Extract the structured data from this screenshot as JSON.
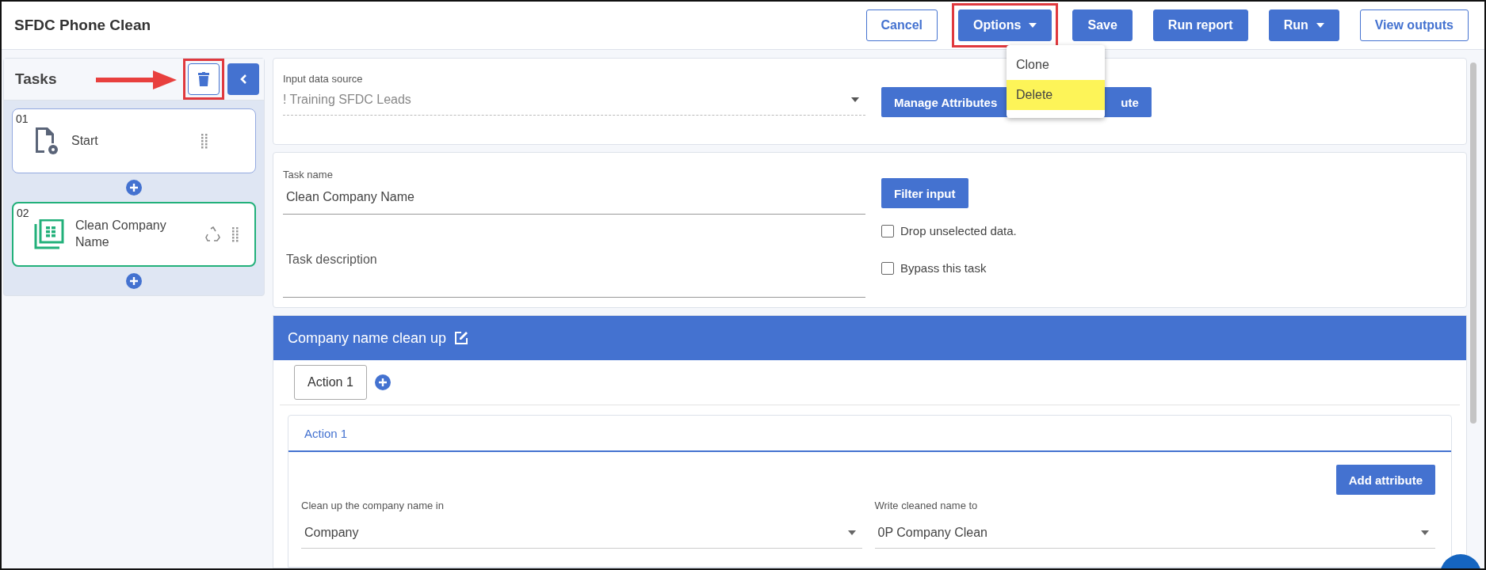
{
  "header": {
    "title": "SFDC Phone Clean",
    "buttons": [
      {
        "label": "Cancel",
        "kind": "outline",
        "caret": false,
        "highlighted": false
      },
      {
        "label": "Options",
        "kind": "solid",
        "caret": true,
        "highlighted": true
      },
      {
        "label": "Save",
        "kind": "solid",
        "caret": false,
        "highlighted": false
      },
      {
        "label": "Run report",
        "kind": "solid",
        "caret": false,
        "highlighted": false
      },
      {
        "label": "Run",
        "kind": "solid",
        "caret": true,
        "highlighted": false
      },
      {
        "label": "View outputs",
        "kind": "outline",
        "caret": false,
        "highlighted": false
      }
    ]
  },
  "options_menu": {
    "items": [
      {
        "label": "Clone",
        "selected": false
      },
      {
        "label": "Delete",
        "selected": true
      }
    ]
  },
  "sidebar": {
    "title": "Tasks",
    "delete_highlighted": true,
    "tasks": [
      {
        "number": "01",
        "name": "Start",
        "kind": "start",
        "selected": false
      },
      {
        "number": "02",
        "name": "Clean Company Name",
        "kind": "table",
        "selected": true
      }
    ]
  },
  "source_card": {
    "label": "Input data source",
    "value": "! Training SFDC Leads",
    "disabled": true,
    "buttons": [
      "Manage Attributes",
      "ute"
    ]
  },
  "task_card": {
    "name_label": "Task name",
    "name_value": "Clean Company Name",
    "description_placeholder": "Task description",
    "filter_button": "Filter input",
    "checkboxes": [
      {
        "label": "Drop unselected data.",
        "checked": false
      },
      {
        "label": "Bypass this task",
        "checked": false
      }
    ]
  },
  "section": {
    "title": "Company name clean up",
    "tabs": [
      {
        "label": "Action 1",
        "selected": true
      }
    ],
    "action": {
      "title": "Action 1",
      "add_button": "Add attribute",
      "fields": [
        {
          "label": "Clean up the company name in",
          "value": "Company"
        },
        {
          "label": "Write cleaned name to",
          "value": "0P Company Clean"
        }
      ]
    }
  }
}
